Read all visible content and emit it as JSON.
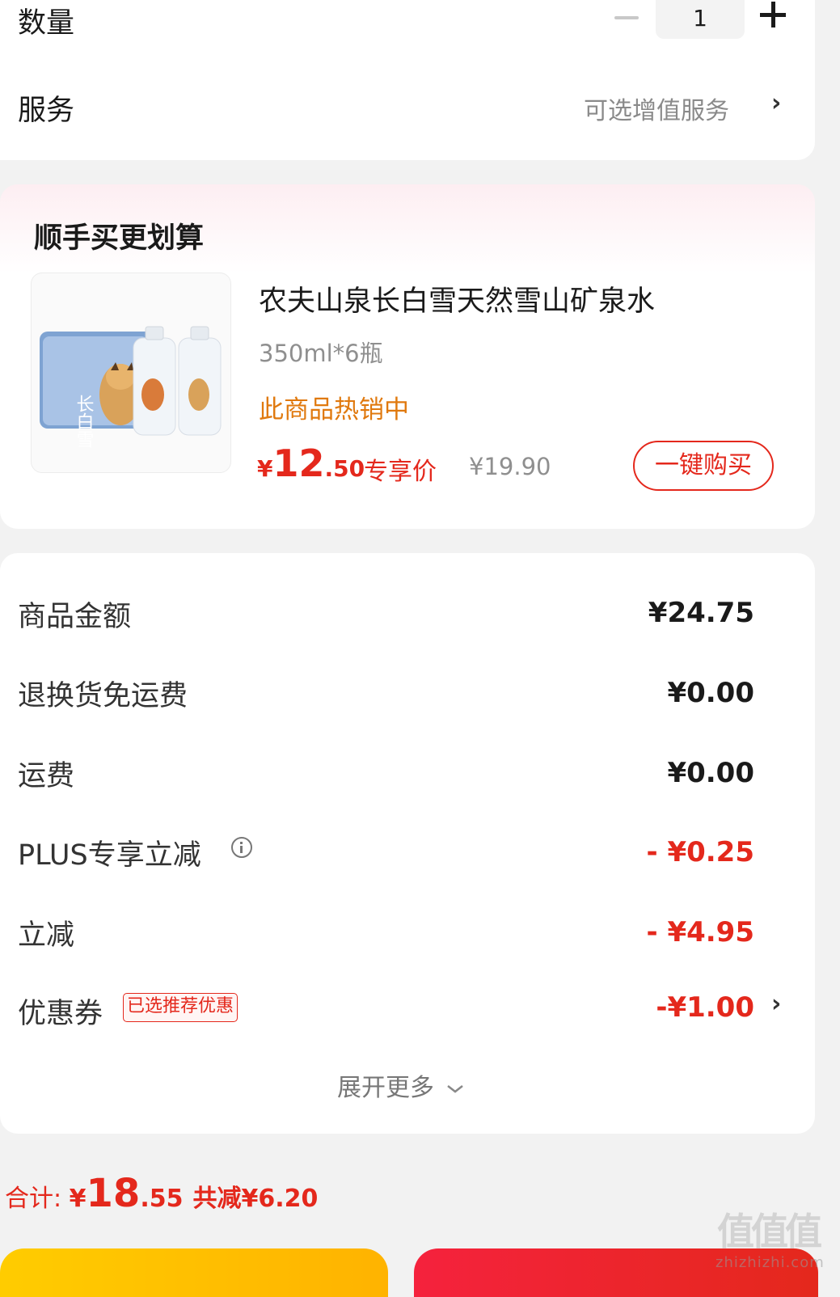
{
  "top": {
    "quantity_label": "数量",
    "quantity_value": "1",
    "service_label": "服务",
    "service_value": "可选增值服务"
  },
  "bundle": {
    "title": "顺手买更划算",
    "product_name": "农夫山泉长白雪天然雪山矿泉水",
    "product_spec": "350ml*6瓶",
    "hot_text": "此商品热销中",
    "price_currency": "¥",
    "price_int": "12",
    "price_dec": ".50",
    "price_tag": "专享价",
    "original_price": "¥19.90",
    "buy_button": "一键购买",
    "image_brand_text": "长白雪"
  },
  "price_details": {
    "rows": [
      {
        "label": "商品金额",
        "value": "¥24.75"
      },
      {
        "label": "退换货免运费",
        "value": "¥0.00"
      },
      {
        "label": "运费",
        "value": "¥0.00"
      },
      {
        "label": "PLUS专享立减",
        "value": "- ¥0.25"
      },
      {
        "label": "立减",
        "value": "- ¥4.95"
      },
      {
        "label": "优惠券",
        "value": "-¥1.00"
      }
    ],
    "coupon_badge": "已选推荐优惠",
    "expand_more": "展开更多"
  },
  "footer": {
    "total_label": "合计: ",
    "total_currency": "¥",
    "total_int": "18",
    "total_dec": ".55",
    "total_saved": "共减¥6.20"
  },
  "watermark": {
    "glyphs": "值值值",
    "text": "zhizhizhi.com"
  },
  "colors": {
    "accent_red": "#e4281c",
    "hot_orange": "#e0790e",
    "muted_gray": "#8f8f8f"
  }
}
